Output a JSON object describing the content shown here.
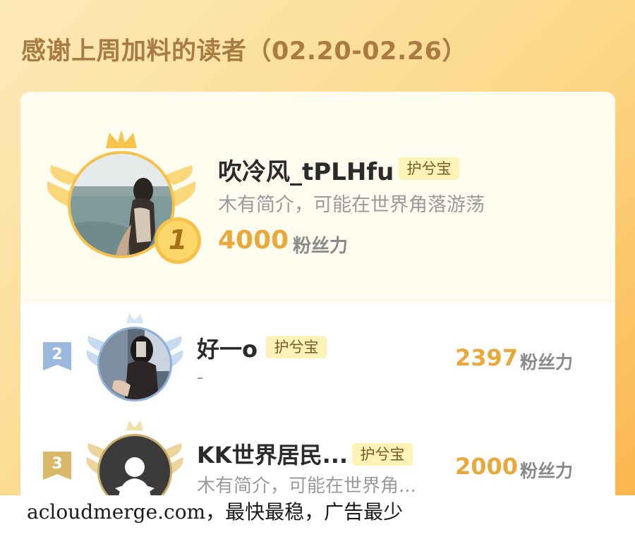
{
  "header": {
    "title": "感谢上周加料的读者（02.20-02.26）"
  },
  "readers": [
    {
      "rank": "1",
      "name": "吹冷风_tPLHfu",
      "badge": "护兮宝",
      "bio": "木有简介，可能在世界角落游荡",
      "fans_value": "4000",
      "fans_label": "粉丝力",
      "avatar_icon": "beach-photo"
    },
    {
      "rank": "2",
      "name": "好一o",
      "badge": "护兮宝",
      "bio": "-",
      "fans_value": "2397",
      "fans_label": "粉丝力",
      "avatar_icon": "selfie-photo"
    },
    {
      "rank": "3",
      "name": "KK世界居民...",
      "badge": "护兮宝",
      "bio": "木有简介，可能在世界角...",
      "fans_value": "2000",
      "fans_label": "粉丝力",
      "avatar_icon": "default-user-icon"
    }
  ],
  "colors": {
    "gold": "#e8a83a",
    "silver": "#9bb9df",
    "bronze": "#d9b86a",
    "title": "#a87b43"
  },
  "watermark": "acloudmerge.com，最快最稳，广告最少"
}
